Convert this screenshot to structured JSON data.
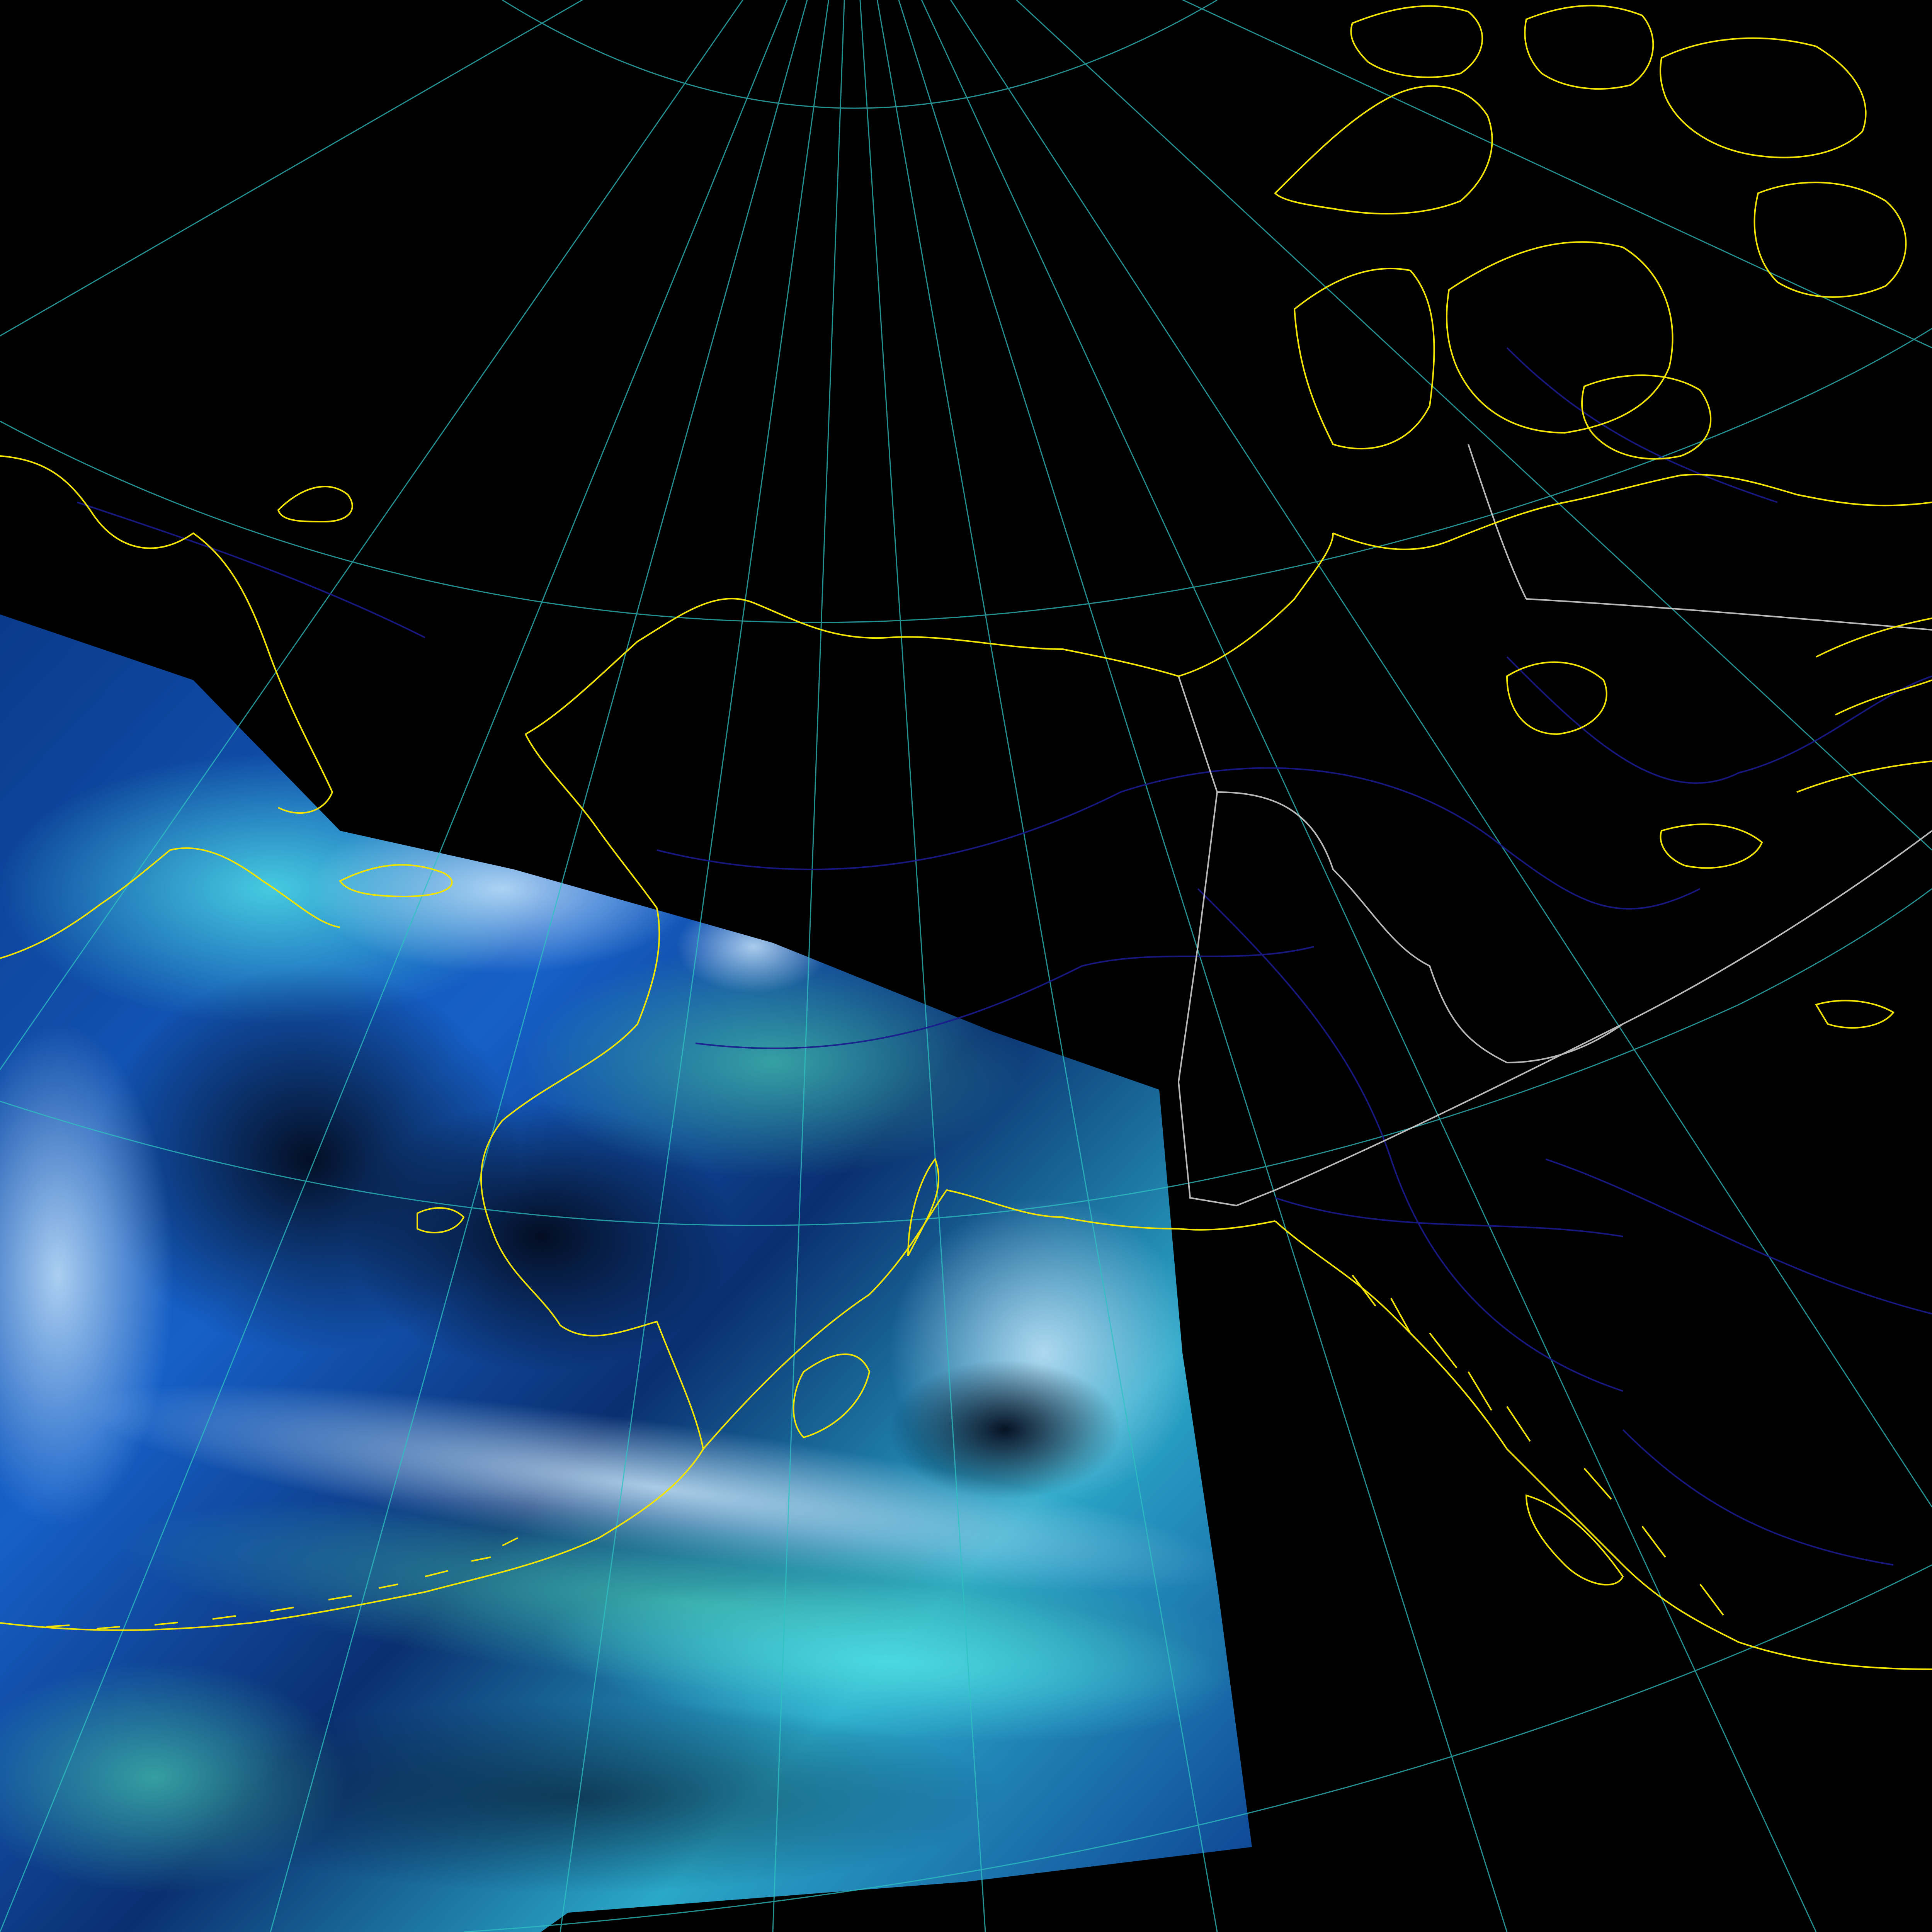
{
  "map": {
    "projection": "polar-stereographic",
    "background": "#000000",
    "colors": {
      "graticule": "#2fc2c2",
      "coastline": "#f2e400",
      "borders": "#d8d8d8",
      "rivers": "#1a1a8c",
      "imagery_deep": "#062a6e",
      "imagery_mid": "#1a6fd0",
      "imagery_cyan": "#3fd0e8",
      "imagery_teal": "#2aa8a0",
      "imagery_cloud": "#bfe6ff"
    },
    "layers": [
      {
        "name": "satellite-swath"
      },
      {
        "name": "graticule"
      },
      {
        "name": "rivers"
      },
      {
        "name": "political-borders"
      },
      {
        "name": "coastlines"
      }
    ]
  }
}
